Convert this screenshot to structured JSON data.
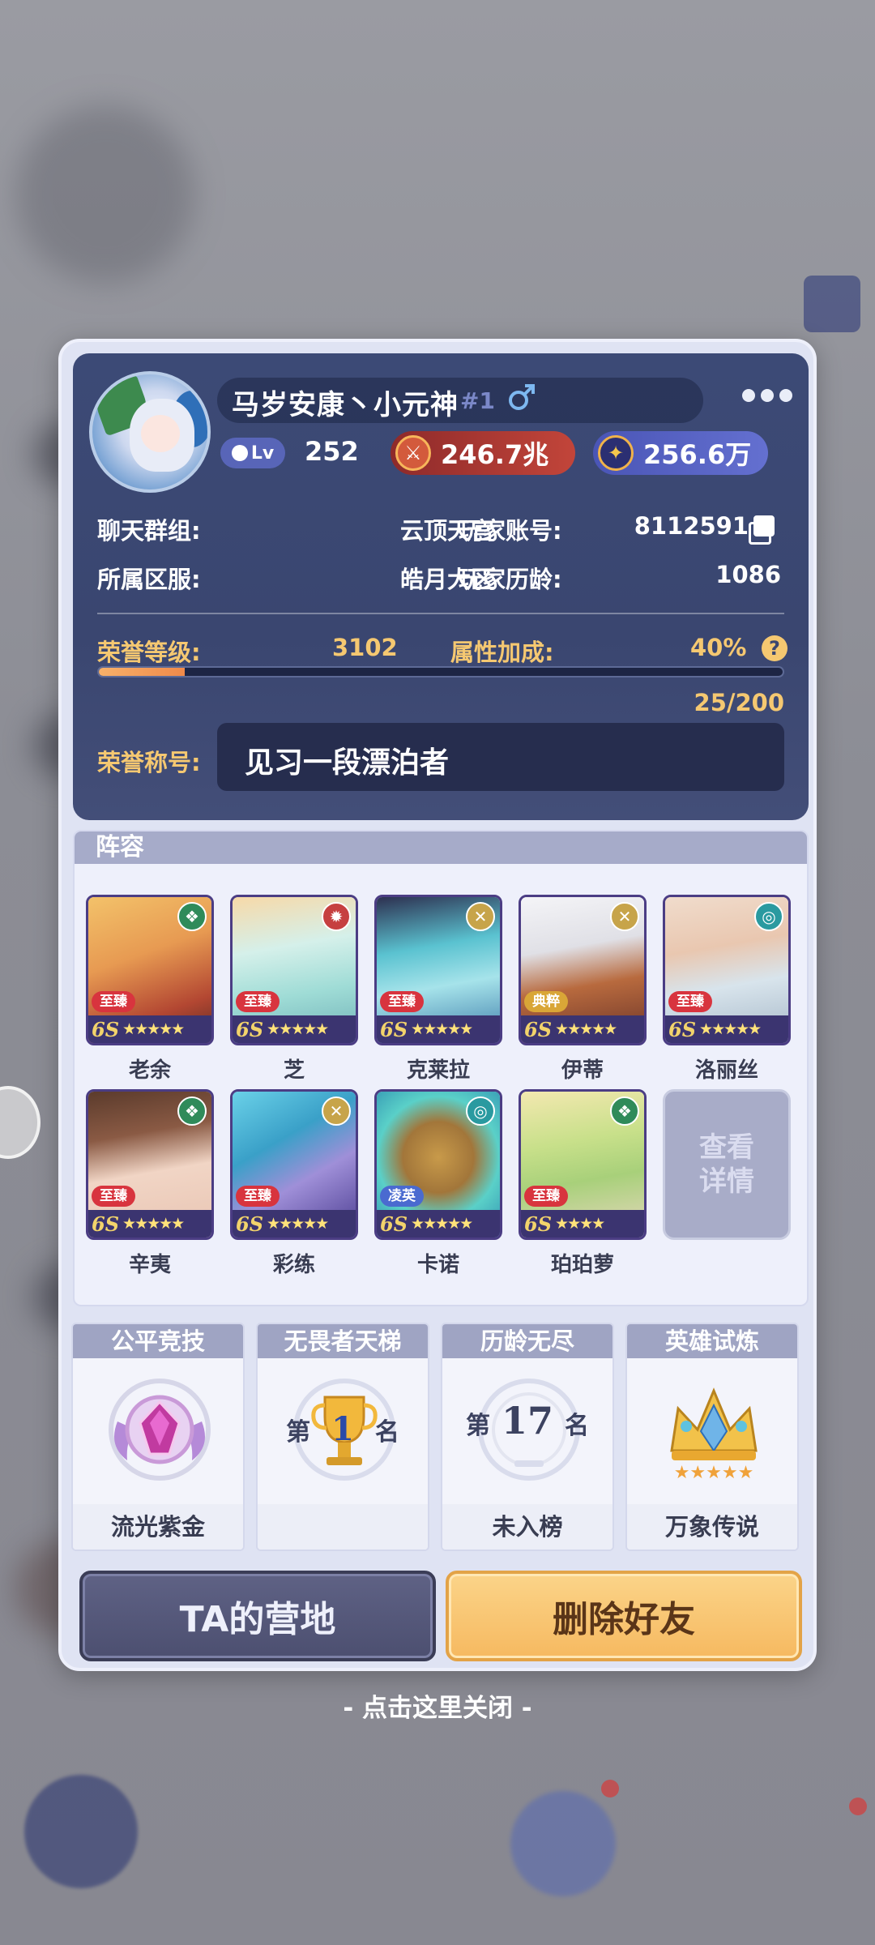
{
  "profile": {
    "name": "马岁安康丶小元神",
    "rank": "#1",
    "level_label": "Lv",
    "level": "252",
    "currency_red": "246.7兆",
    "currency_blue": "256.6万",
    "chat_group_label": "聊天群组:",
    "chat_group": "云顶天宫",
    "account_label": "玩家账号:",
    "account": "8112591",
    "server_label": "所属区服:",
    "server": "皓月大区",
    "age_label": "玩家历龄:",
    "age": "1086",
    "honor_level_label": "荣誉等级:",
    "honor_level": "3102",
    "attr_bonus_label": "属性加成:",
    "attr_bonus": "40%",
    "honor_progress_text": "25/200",
    "honor_progress": 0.125,
    "honor_title_label": "荣誉称号:",
    "honor_title": "见习一段漂泊者"
  },
  "lineup": {
    "header": "阵容",
    "heroes": [
      {
        "name": "老余",
        "tag": "至臻",
        "grade": "6S",
        "stars": "★★★★★"
      },
      {
        "name": "芝",
        "tag": "至臻",
        "grade": "6S",
        "stars": "★★★★★"
      },
      {
        "name": "克莱拉",
        "tag": "至臻",
        "grade": "6S",
        "stars": "★★★★★"
      },
      {
        "name": "伊蒂",
        "tag": "典粹",
        "grade": "6S",
        "stars": "★★★★★"
      },
      {
        "name": "洛丽丝",
        "tag": "至臻",
        "grade": "6S",
        "stars": "★★★★★"
      },
      {
        "name": "辛夷",
        "tag": "至臻",
        "grade": "6S",
        "stars": "★★★★★"
      },
      {
        "name": "彩练",
        "tag": "至臻",
        "grade": "6S",
        "stars": "★★★★★"
      },
      {
        "name": "卡诺",
        "tag": "凌英",
        "grade": "6S",
        "stars": "★★★★★"
      },
      {
        "name": "珀珀萝",
        "tag": "至臻",
        "grade": "6S",
        "stars": "★★★★"
      }
    ],
    "view_detail": "查看详情"
  },
  "stats": [
    {
      "title": "公平竞技",
      "footer": "流光紫金"
    },
    {
      "title": "无畏者天梯",
      "rank_prefix": "第",
      "rank_number": "1",
      "rank_suffix": "名",
      "footer": ""
    },
    {
      "title": "历龄无尽",
      "rank_prefix": "第",
      "rank_number": "17",
      "rank_suffix": "名",
      "footer": "未入榜"
    },
    {
      "title": "英雄试炼",
      "footer": "万象传说"
    }
  ],
  "buttons": {
    "camp": "TA的营地",
    "delete": "删除好友"
  },
  "close_hint": "- 点击这里关闭 -",
  "colors": {
    "accent_gold": "#f5c871",
    "card_bg": "#3c4a76",
    "delete_btn": "#f6b960",
    "camp_btn": "#4c4f70"
  }
}
